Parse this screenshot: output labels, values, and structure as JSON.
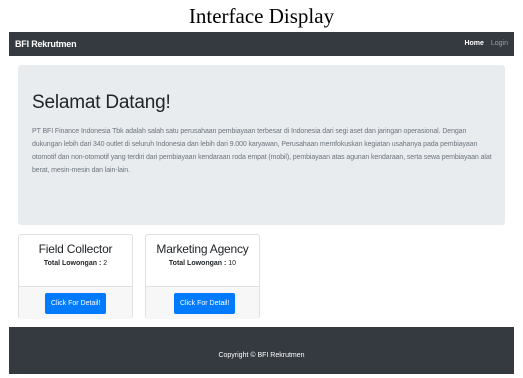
{
  "caption": "Interface Display",
  "navbar": {
    "brand": "BFI Rekrutmen",
    "links": [
      "Home",
      "Login"
    ]
  },
  "jumbotron": {
    "title": "Selamat Datang!",
    "text": "PT BFI Finance Indonesia Tbk adalah salah satu perusahaan pembiayaan terbesar di Indonesia dari segi aset dan jaringan operasional. Dengan dukungan lebih dari 340 outlet di seluruh Indonesia dan lebih dari 9.000 karyawan, Perusahaan memfokuskan kegiatan usahanya pada pembiayaan otomotif dan non-otomotif yang terdiri dari pembiayaan kendaraan roda empat (mobil), pembiayaan atas agunan kendaraan, serta sewa pembiayaan alat berat, mesin-mesin dan lain-lain."
  },
  "jobs": [
    {
      "title": "Field Collector",
      "count_label": "Total Lowongan :",
      "count": "2",
      "button": "Click For Detail!"
    },
    {
      "title": "Marketing Agency",
      "count_label": "Total Lowongan :",
      "count": "10",
      "button": "Click For Detail!"
    }
  ],
  "footer": {
    "copyright": "Copyright © BFI Rekrutmen"
  },
  "colors": {
    "navbar": "#343a40",
    "jumbotron": "#e9ecef",
    "button": "#007bff"
  }
}
